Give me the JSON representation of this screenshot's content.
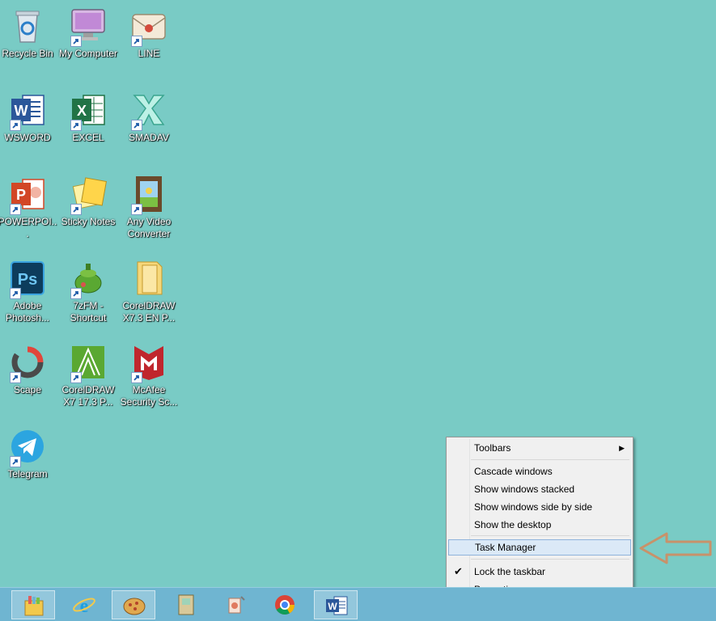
{
  "desktop": {
    "icons": [
      {
        "label": "Recycle Bin",
        "icon": "recycle-bin-icon"
      },
      {
        "label": "My Computer",
        "icon": "my-computer-icon"
      },
      {
        "label": "LINE",
        "icon": "line-icon"
      },
      {
        "label": "WSWORD",
        "icon": "word-icon"
      },
      {
        "label": "EXCEL",
        "icon": "excel-icon"
      },
      {
        "label": "SMADAV",
        "icon": "smadav-icon"
      },
      {
        "label": "POWERPOI...",
        "icon": "powerpoint-icon"
      },
      {
        "label": "Sticky Notes",
        "icon": "sticky-notes-icon"
      },
      {
        "label": "Any Video Converter",
        "icon": "video-converter-icon"
      },
      {
        "label": "Adobe Photosh...",
        "icon": "photoshop-icon"
      },
      {
        "label": "7zFM - Shortcut",
        "icon": "7zip-icon"
      },
      {
        "label": "CorelDRAW X7.3 EN P...",
        "icon": "folder-icon"
      },
      {
        "label": "Scape",
        "icon": "scape-icon"
      },
      {
        "label": "CorelDRAW X7 17.3 P...",
        "icon": "coreldraw-icon"
      },
      {
        "label": "McAfee Security Sc...",
        "icon": "mcafee-icon"
      },
      {
        "label": "Telegram",
        "icon": "telegram-icon"
      }
    ]
  },
  "context_menu": {
    "toolbars": "Toolbars",
    "cascade": "Cascade windows",
    "stacked": "Show windows stacked",
    "side_by_side": "Show windows side by side",
    "show_desktop": "Show the desktop",
    "task_manager": "Task Manager",
    "lock_taskbar": "Lock the taskbar",
    "lock_checked": true,
    "properties": "Properties"
  },
  "taskbar": {
    "items": [
      {
        "icon": "file-manager-icon",
        "active": true
      },
      {
        "icon": "internet-explorer-icon",
        "active": false
      },
      {
        "icon": "pizza-app-icon",
        "active": true
      },
      {
        "icon": "notebook-icon",
        "active": false
      },
      {
        "icon": "paint-app-icon",
        "active": false
      },
      {
        "icon": "chrome-icon",
        "active": false
      },
      {
        "icon": "word-icon",
        "active": true
      }
    ]
  },
  "colors": {
    "desktop_bg": "#79cbc5",
    "taskbar_bg": "#6fb5d1",
    "menu_highlight": "#dbe9f7",
    "annotation_arrow": "#c8926a"
  }
}
